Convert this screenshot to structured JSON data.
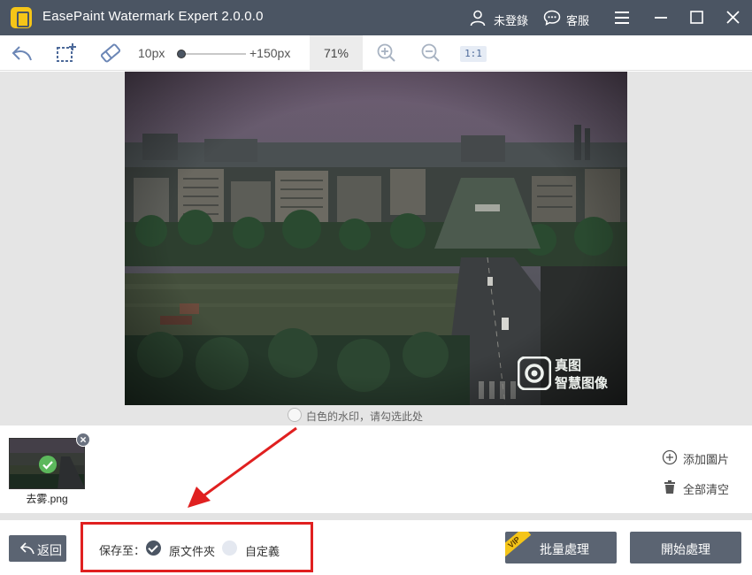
{
  "app": {
    "title": "EasePaint Watermark Expert  2.0.0.0",
    "user_label": "未登錄",
    "service_label": "客服"
  },
  "toolbar": {
    "brush_min": "10px",
    "brush_max": "+150px",
    "brush_level_fraction": 0.0,
    "zoom": "71%",
    "one_to_one": "1:1"
  },
  "image": {
    "watermark_line1": "真图",
    "watermark_line2": "智慧图像",
    "white_watermark_label": "白色的水印，请勾选此处"
  },
  "thumbnails": [
    {
      "name": "去雾.png",
      "checked": true
    }
  ],
  "side_actions": {
    "add_label": "添加圖片",
    "clear_label": "全部清空"
  },
  "bottom": {
    "back_label": "返回",
    "save_to_label": "保存至：",
    "option_original": "原文件夾",
    "option_custom": "自定義",
    "selected_option": "original",
    "vip_badge": "VIP",
    "batch_label": "批量處理",
    "start_label": "開始處理"
  },
  "colors": {
    "titlebar": "#4b5563",
    "button": "#5b6472",
    "highlight_box": "#e02020",
    "check_green": "#5cb85c",
    "vip_yellow": "#f5c518"
  }
}
